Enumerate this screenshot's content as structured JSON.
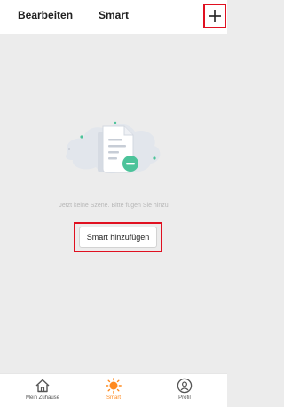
{
  "header": {
    "edit_label": "Bearbeiten",
    "title": "Smart",
    "add_icon": "plus-icon"
  },
  "main": {
    "empty_illustration": "scene-list-empty-illustration",
    "empty_message": "Jetzt keine Szene. Bitte fügen Sie hinzu",
    "add_smart_button_label": "Smart hinzufügen"
  },
  "bottom_nav": {
    "items": [
      {
        "label": "Mein Zuhause",
        "icon": "home-icon",
        "active": false
      },
      {
        "label": "Smart",
        "icon": "sun-icon",
        "active": true
      },
      {
        "label": "Profil",
        "icon": "profile-icon",
        "active": false
      }
    ]
  },
  "colors": {
    "accent": "#ff8a1f",
    "highlight": "#e01020",
    "illustration_green": "#4cc39a",
    "background": "#ececec"
  }
}
